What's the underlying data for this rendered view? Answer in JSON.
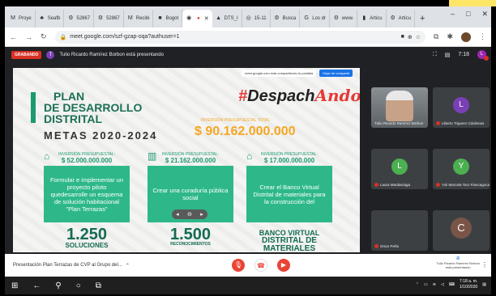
{
  "browser": {
    "tabs": [
      {
        "icon": "M",
        "label": "Proye",
        "active": false
      },
      {
        "icon": "♣",
        "label": "Seafb",
        "active": false
      },
      {
        "icon": "⚙",
        "label": "52867",
        "active": false
      },
      {
        "icon": "⚙",
        "label": "52867",
        "active": false
      },
      {
        "icon": "M",
        "label": "Recibi",
        "active": false
      },
      {
        "icon": "■",
        "label": "Bogot",
        "active": false
      },
      {
        "icon": "◉",
        "label": "",
        "active": true
      },
      {
        "icon": "▲",
        "label": "DTS_I",
        "active": false
      },
      {
        "icon": "◎",
        "label": "15-11",
        "active": false
      },
      {
        "icon": "⚙",
        "label": "Busca",
        "active": false
      },
      {
        "icon": "G",
        "label": "Los dr",
        "active": false
      },
      {
        "icon": "⚙",
        "label": "www.",
        "active": false
      },
      {
        "icon": "▮",
        "label": "Articu",
        "active": false
      },
      {
        "icon": "⚙",
        "label": "Articu",
        "active": false
      }
    ],
    "url": "meet.google.com/szf-gzap-oqa?authuser=1"
  },
  "meet": {
    "recording_label": "GRABANDO",
    "presenter_initial": "T",
    "presenter_text": "Tulio Ricardo Ramírez Borbon está presentando",
    "time": "7:18",
    "user_initial": "L",
    "overlay_text": "meet.google.com está compartiendo tu pantalla",
    "overlay_button": "Dejar de compartir"
  },
  "slide": {
    "title_l1": "PLAN",
    "title_l2": "DE DESARROLLO",
    "title_l3": "DISTRITAL",
    "metas": "METAS 2020-2024",
    "logo_hash": "#",
    "logo_text": "Despach",
    "logo_red": "Ando",
    "inv_total_label": "INVERSIÓN PRESUPUESTAL TOTAL",
    "inv_total": "$ 90.162.000.000",
    "columns": [
      {
        "label": "INVERSIÓN PRESUPUESTAL:",
        "value": "$ 52.000.000.000",
        "text": "Formular e implementar un proyecto piloto quedesarrolle un esquema de solución habitacional \"Plan Terrazas\"",
        "num": "1.250",
        "unit": "SOLUCIONES",
        "unit_small": false
      },
      {
        "label": "INVERSIÓN PRESUPUESTAL:",
        "value": "$ 21.162.000.000",
        "text": "Crear una curaduría pública social",
        "num": "1.500",
        "unit": "RECONOCIMIENTOS",
        "unit_small": true
      },
      {
        "label": "INVERSIÓN PRESUPUESTAL:",
        "value": "$ 17.000.000.000",
        "text": "Crear el Banco Virtual Distrital de materiales para la construcción del",
        "num": "BANCO VIRTUAL",
        "unit": "DISTRITAL DE MATERIALES",
        "unit_small": false
      }
    ]
  },
  "participants": [
    {
      "name": "Tulio Ricardo Ramírez Borbon",
      "initial": "",
      "video": true
    },
    {
      "name": "Liberto Triguero Cárdenas",
      "initial": "L",
      "color": "#7b3fb5"
    },
    {
      "name": "Laura Mardarriaga",
      "initial": "L",
      "color": "#4caf50"
    },
    {
      "name": "Yuli Marcela Toro Fiancagoca",
      "initial": "Y",
      "color": "#4caf50"
    },
    {
      "name": "Omar Peña",
      "initial": "",
      "color": ""
    },
    {
      "name": "",
      "initial": "C",
      "color": "#795548"
    }
  ],
  "callbar": {
    "meeting_title": "Presentación Plan Terrazas de CVP al Grupo del...",
    "right_l1": "Tulio Ricardo Ramírez Borbon",
    "right_l2": "está presentando"
  },
  "taskbar": {
    "time": "7:18 a. m.",
    "date": "1/10/2020"
  }
}
